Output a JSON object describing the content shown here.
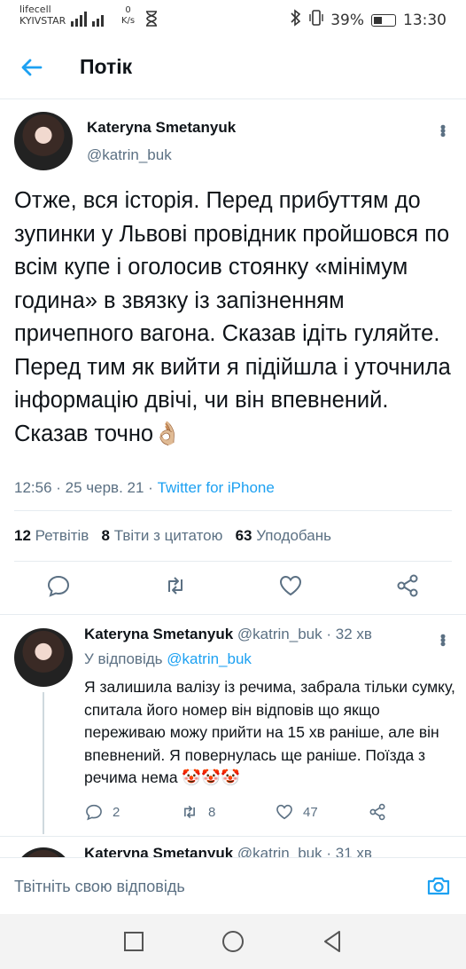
{
  "status_bar": {
    "carrier1": "lifecell",
    "carrier2": "KYIVSTAR",
    "net_speed": "0",
    "net_unit": "K/s",
    "battery": "39%",
    "time": "13:30"
  },
  "header": {
    "title": "Потік"
  },
  "main_tweet": {
    "name": "Kateryna Smetanyuk",
    "handle": "@katrin_buk",
    "text": "Отже, вся історія. Перед прибуттям до зупинки у Львові провідник пройшовся по всім купе і оголосив стоянку «мінімум година» в звязку із запізненням причепного вагона. Сказав ідіть гуляйте. Перед тим як вийти я підійшла і уточнила інформацію двічі, чи він впевнений. Сказав точно👌🏼",
    "time": "12:56",
    "date": "25 черв. 21",
    "source": "Twitter for iPhone",
    "retweets_count": "12",
    "retweets_label": "Ретвітів",
    "quotes_count": "8",
    "quotes_label": "Твіти з цитатою",
    "likes_count": "63",
    "likes_label": "Уподобань"
  },
  "reply": {
    "name": "Kateryna Smetanyuk",
    "handle": "@katrin_buk",
    "age": "32 хв",
    "reply_to_label": "У відповідь",
    "reply_to_handle": "@katrin_buk",
    "text": "Я залишила валізу із речима, забрала тільки сумку, спитала його номер він відповів що якщо переживаю можу прийти на 15 хв раніше, але він впевнений. Я повернулась ще раніше. Поїзда з речима нема 🤡🤡🤡",
    "replies": "2",
    "retweets": "8",
    "likes": "47"
  },
  "reply2": {
    "name": "Kateryna Smetanyuk",
    "handle": "@katrin_buk",
    "age": "31 хв"
  },
  "composer": {
    "placeholder": "Твітніть свою відповідь"
  },
  "colors": {
    "accent": "#1da1f2",
    "muted": "#5b7083",
    "text": "#0f1419"
  }
}
